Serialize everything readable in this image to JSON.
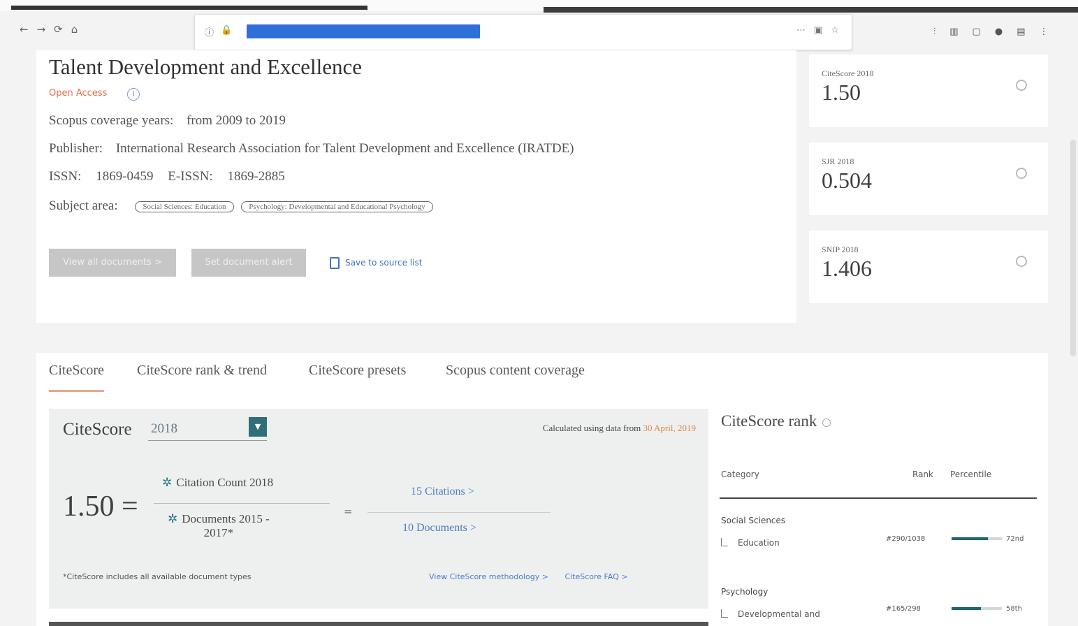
{
  "browser": {
    "url": "",
    "nav_icons": [
      "←",
      "→",
      "⟳",
      "⌂"
    ],
    "url_icons_left": [
      "ⓘ",
      "🔒"
    ],
    "url_icons_right": [
      "⋯",
      "▣",
      "☆"
    ],
    "toolbar_icons": [
      "⫶",
      "▥",
      "▢",
      "●",
      "▤",
      "⋮"
    ]
  },
  "journal": {
    "title": "Talent Development and Excellence",
    "open_access": "Open Access",
    "coverage_label": "Scopus coverage years:",
    "coverage_value": "from 2009 to 2019",
    "publisher_label": "Publisher:",
    "publisher_value": "International Research Association for Talent Development and Excellence (IRATDE)",
    "issn_label": "ISSN:",
    "issn_value": "1869-0459",
    "eissn_label": "E-ISSN:",
    "eissn_value": "1869-2885",
    "subject_label": "Subject area:",
    "subjects": [
      "Social Sciences: Education",
      "Psychology: Developmental and Educational Psychology"
    ],
    "btn_view_all": "View all documents >",
    "btn_alert": "Set document alert",
    "save_link": "Save to source list"
  },
  "metrics": [
    {
      "label": "CiteScore 2018",
      "value": "1.50"
    },
    {
      "label": "SJR 2018",
      "value": "0.504"
    },
    {
      "label": "SNIP 2018",
      "value": "1.406"
    }
  ],
  "tabs": [
    "CiteScore",
    "CiteScore rank & trend",
    "CiteScore presets",
    "Scopus content coverage"
  ],
  "citescore": {
    "title": "CiteScore",
    "year": "2018",
    "calc_prefix": "Calculated using data from",
    "calc_date": "30 April, 2019",
    "score": "1.50",
    "equals": "=",
    "numerator_label": "Citation Count 2018",
    "denominator_label_1": "Documents 2015 -",
    "denominator_label_2": "2017*",
    "citations_link": "15 Citations >",
    "documents_link": "10 Documents >",
    "footnote": "*CiteScore includes all available document types",
    "methodology_link": "View CiteScore methodology >",
    "faq_link": "CiteScore FAQ >"
  },
  "rank": {
    "title": "CiteScore rank",
    "col_category": "Category",
    "col_rank": "Rank",
    "col_percentile": "Percentile",
    "rows": [
      {
        "category": "Social Sciences",
        "subcategory": "Education",
        "rank": "#290/1038",
        "percentile": "72nd",
        "percentile_value": 72
      },
      {
        "category": "Psychology",
        "subcategory": "Developmental and",
        "rank": "#165/298",
        "percentile": "58th",
        "percentile_value": 58
      }
    ]
  }
}
